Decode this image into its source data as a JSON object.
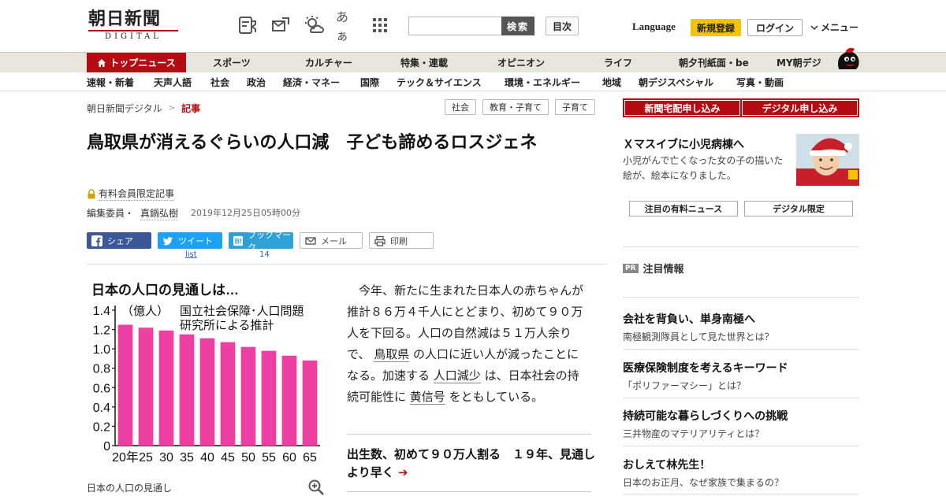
{
  "header": {
    "logo_main": "朝日新聞",
    "logo_sub": "DIGITAL",
    "aa_label": "あぁ",
    "search_placeholder": "",
    "search_button": "検索",
    "toc_button": "目次",
    "language": "Language",
    "register": "新規登録",
    "login": "ログイン",
    "menu": "メニュー"
  },
  "nav1": {
    "home": "トップニュース",
    "items": [
      "スポーツ",
      "カルチャー",
      "特集・連載",
      "オピニオン",
      "ライフ",
      "朝夕刊紙面・be",
      "MY朝デジ"
    ]
  },
  "nav2": {
    "items": [
      "速報・新着",
      "天声人語",
      "社会",
      "政治",
      "経済・マネー",
      "国際",
      "テック＆サイエンス",
      "環境・エネルギー",
      "地域",
      "朝デジスペシャル",
      "写真・動画"
    ]
  },
  "breadcrumb": {
    "root": "朝日新聞デジタル",
    "sep": ">",
    "current": "記事"
  },
  "tags": [
    "社会",
    "教育・子育て",
    "子育て"
  ],
  "article": {
    "title": "鳥取県が消えるぐらいの人口減　子ども諦めるロスジェネ",
    "paid_label": "有料会員限定記事",
    "author_role": "編集委員・",
    "author_name": "真鍋弘樹",
    "date": "2019年12月25日05時00分",
    "body_p1": "今年、新たに生まれた日本人の赤ちゃんが推計８６万４千人にとどまり、初めて９０万人を下回る。人口の自然減は５１万人余りで、",
    "kw1": "鳥取県",
    "body_p2": "の人口に近い人が減ったことになる。加速する",
    "kw2": "人口減少",
    "body_p3": "は、日本社会の持続可能性に",
    "kw3": "黄信号",
    "body_p4": "をともしている。",
    "related_title": "出生数、初めて９０万人割る　１９年、見通しより早く",
    "related_arrow": "➔",
    "chart_caption": "日本の人口の見通し"
  },
  "share": {
    "facebook": "シェア",
    "twitter": "ツイート",
    "twitter_sub": "list",
    "hatena": "ブックマーク",
    "hatena_sub": "14",
    "mail": "メール",
    "print": "印刷"
  },
  "chart_data": {
    "type": "bar",
    "title": "日本の人口の見通しは…",
    "ylabel": "（億人）",
    "annotation": "国立社会保障･人口問題研究所による推計",
    "categories": [
      "20年",
      "25",
      "30",
      "35",
      "40",
      "45",
      "50",
      "55",
      "60",
      "65"
    ],
    "values": [
      1.25,
      1.22,
      1.19,
      1.15,
      1.11,
      1.07,
      1.02,
      0.98,
      0.93,
      0.88
    ],
    "yticks": [
      "0",
      "0.2",
      "0.4",
      "0.6",
      "0.8",
      "1.0",
      "1.2",
      "1.4"
    ],
    "ylim": [
      0,
      1.4
    ],
    "bar_color": "#ee3fa2"
  },
  "sidebar": {
    "sub_newspaper": "新聞宅配申し込み",
    "sub_digital": "デジタル申し込み",
    "promo_title": "Ｘマスイブに小児病棟へ",
    "promo_desc": "小児がんで亡くなった女の子の描いた絵が、絵本になりました。",
    "tab1": "注目の有料ニュース",
    "tab2": "デジタル限定",
    "pr_badge": "PR",
    "pr_head": "注目情報",
    "pr_items": [
      {
        "title": "会社を背負い、単身南極へ",
        "desc": "南極観測隊員として見た世界とは？"
      },
      {
        "title": "医療保険制度を考えるキーワード",
        "desc": "「ポリファーマシー」とは？"
      },
      {
        "title": "持続可能な暮らしづくりへの挑戦",
        "desc": "三井物産のマテリアリティとは？"
      },
      {
        "title": "おしえて林先生！",
        "desc": "日本のお正月、なぜ家族で集まるの？"
      }
    ]
  },
  "colors": {
    "brand_red": "#b40c12",
    "register_yellow": "#f4c400"
  }
}
